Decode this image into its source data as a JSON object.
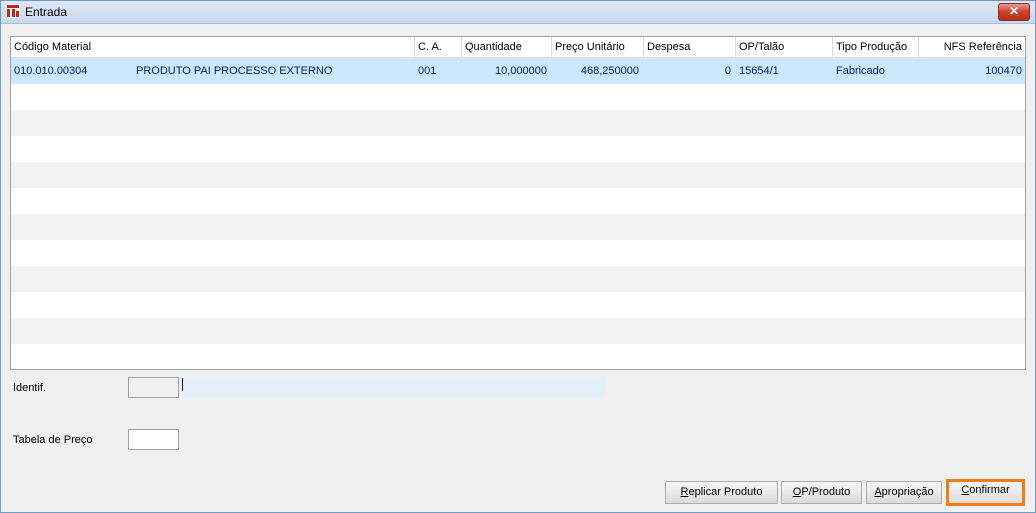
{
  "window": {
    "title": "Entrada",
    "close_label": "✕"
  },
  "grid": {
    "columns": [
      "Código Material",
      "C. A.",
      "Quantidade",
      "Preço Unitário",
      "Despesa",
      "OP/Talão",
      "Tipo Produção",
      "NFS Referência"
    ],
    "rows": [
      {
        "codigo": "010.010.00304",
        "descricao": "PRODUTO PAI PROCESSO EXTERNO",
        "ca": "001",
        "quantidade": "10,000000",
        "preco": "468,250000",
        "despesa": "0",
        "op": "15654/1",
        "tipo": "Fabricado",
        "nfs": "100470"
      }
    ]
  },
  "form": {
    "identif_label": "Identif.",
    "tabela_label": "Tabela de Preço"
  },
  "buttons": {
    "replicar": {
      "mnemonic": "R",
      "rest": "eplicar Produto"
    },
    "op_produto": {
      "mnemonic": "O",
      "rest": "P/Produto"
    },
    "apropriacao": {
      "mnemonic": "A",
      "rest": "propriação"
    },
    "confirmar": {
      "mnemonic": "C",
      "rest": "onfirmar"
    }
  },
  "colors": {
    "selection": "#cce8ff",
    "focus_border": "#ee7d1a",
    "title_gradient": "#dfe9f5"
  }
}
